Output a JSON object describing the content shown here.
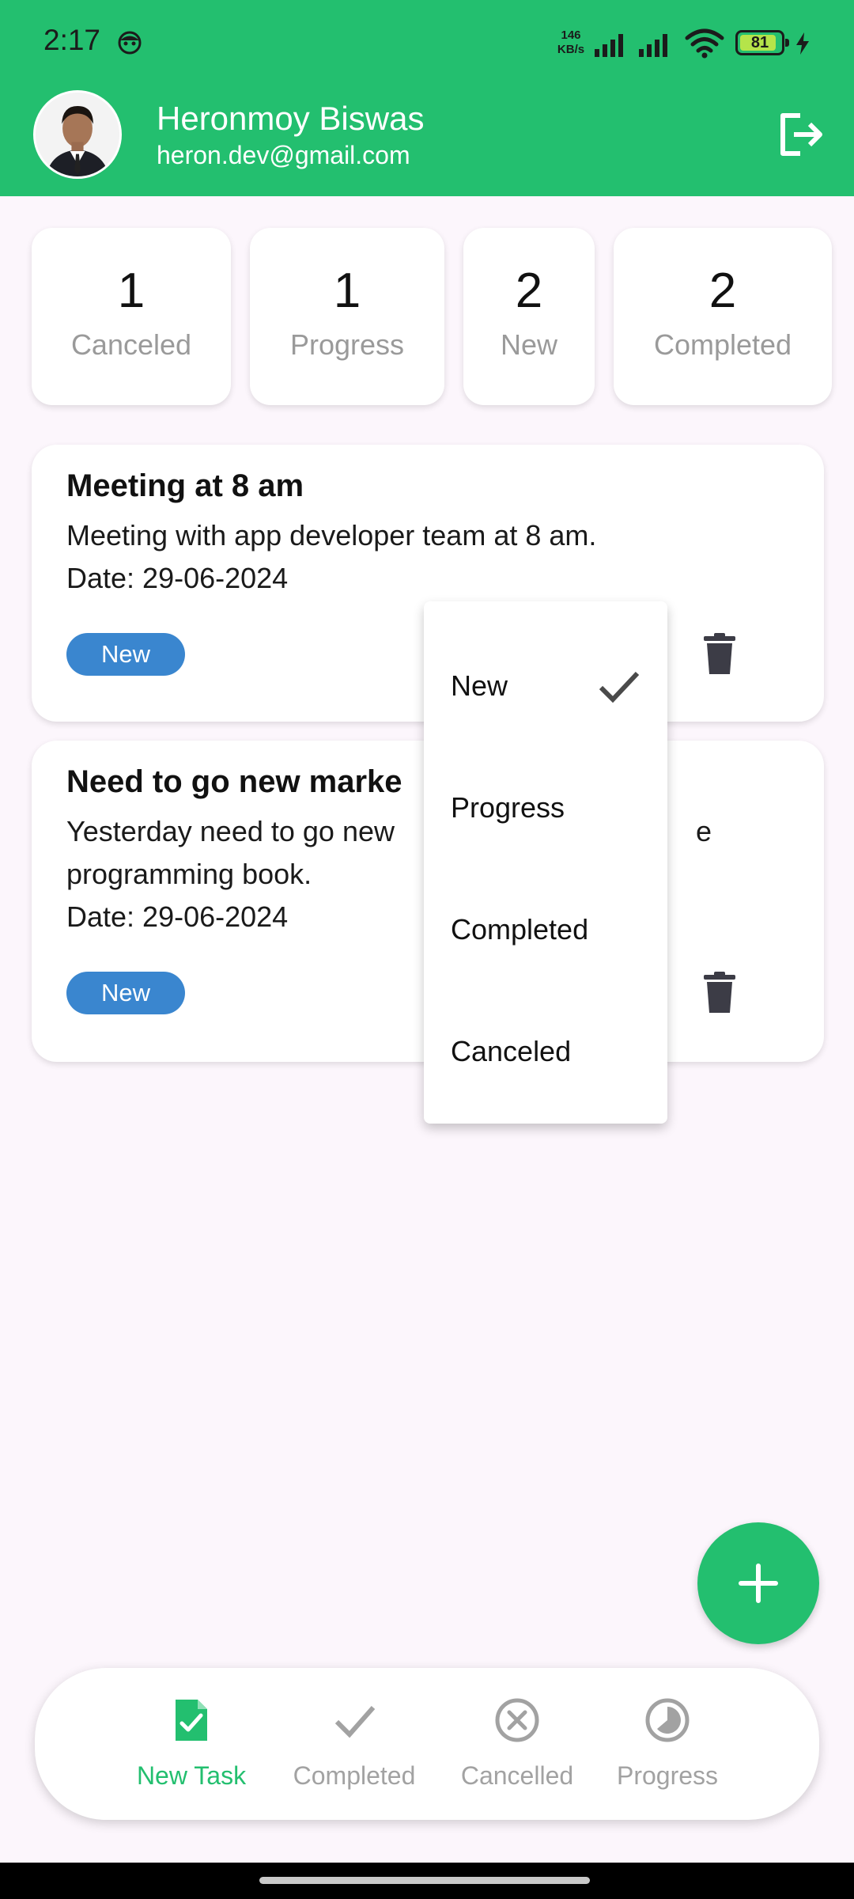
{
  "status_bar": {
    "time": "2:17",
    "net_rate_value": "146",
    "net_rate_unit": "KB/s",
    "battery": "81",
    "icons": [
      "face-icon",
      "signal-icon",
      "signal-icon",
      "wifi-icon",
      "battery-icon",
      "charging-icon"
    ]
  },
  "header": {
    "user_name": "Heronmoy Biswas",
    "user_email": "heron.dev@gmail.com",
    "logout_icon": "logout-icon",
    "accent_color": "#23bf6f"
  },
  "summary": [
    {
      "count": "1",
      "label": "Canceled"
    },
    {
      "count": "1",
      "label": "Progress"
    },
    {
      "count": "2",
      "label": "New"
    },
    {
      "count": "2",
      "label": "Completed"
    }
  ],
  "tasks": [
    {
      "title": "Meeting at 8 am",
      "description": "Meeting with app developer team at 8 am.",
      "date": "Date: 29-06-2024",
      "status": "New"
    },
    {
      "title": "Need to go new marke",
      "description_line1": "Yesterday need to go new",
      "description_tail": "e",
      "description_line2": "programming book.",
      "date": "Date: 29-06-2024",
      "status": "New"
    }
  ],
  "status_menu": {
    "items": [
      "New",
      "Progress",
      "Completed",
      "Canceled"
    ],
    "selected": "New"
  },
  "fab": {
    "icon": "plus-icon"
  },
  "bottom_nav": {
    "items": [
      {
        "label": "New Task",
        "icon": "new-task-icon",
        "active": true
      },
      {
        "label": "Completed",
        "icon": "check-icon",
        "active": false
      },
      {
        "label": "Cancelled",
        "icon": "cancel-icon",
        "active": false
      },
      {
        "label": "Progress",
        "icon": "progress-icon",
        "active": false
      }
    ],
    "active_color": "#23bf6f",
    "inactive_color": "#a2a2a2"
  }
}
